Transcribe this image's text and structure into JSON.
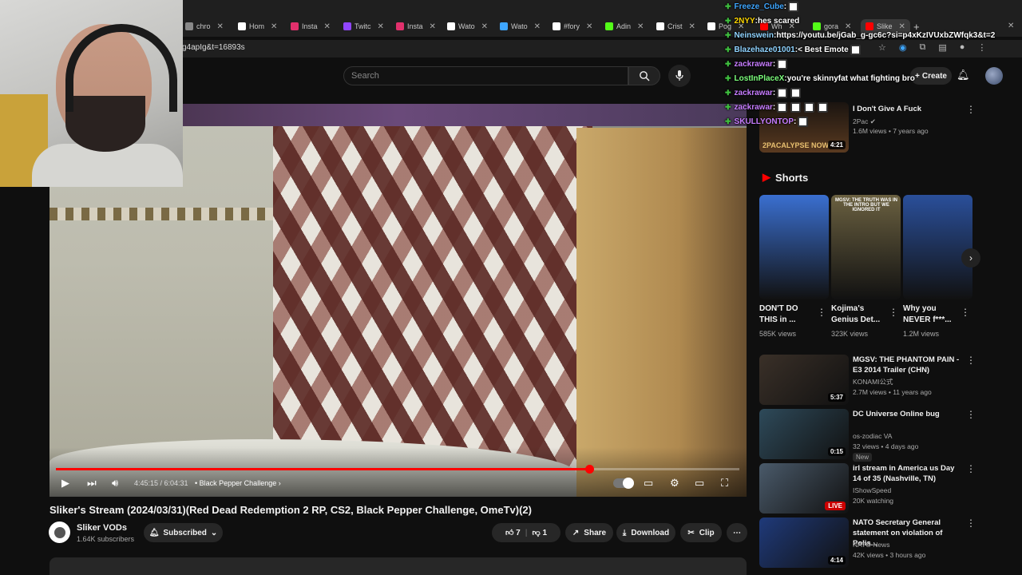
{
  "browser": {
    "tabs": [
      {
        "label": "chro",
        "color": "#888888"
      },
      {
        "label": "Hom",
        "color": "#ffffff"
      },
      {
        "label": "Insta",
        "color": "#e1306c"
      },
      {
        "label": "Twitc",
        "color": "#9146ff"
      },
      {
        "label": "Insta",
        "color": "#e1306c"
      },
      {
        "label": "Wato",
        "color": "#ffffff"
      },
      {
        "label": "Wato",
        "color": "#3ea6ff"
      },
      {
        "label": "#fory",
        "color": "#ffffff"
      },
      {
        "label": "Adin",
        "color": "#53fc18"
      },
      {
        "label": "Crist",
        "color": "#ffffff"
      },
      {
        "label": "Pog",
        "color": "#ffffff"
      },
      {
        "label": "Wh",
        "color": "#ff0000"
      },
      {
        "label": "gora",
        "color": "#53fc18"
      },
      {
        "label": "Slike",
        "color": "#ff0000"
      }
    ],
    "new_tab": "+",
    "url": "g4apIg&t=16893s"
  },
  "header": {
    "search_placeholder": "Search",
    "create_label": "Create"
  },
  "player": {
    "time": "4:45:15 / 6:04:31",
    "chapter": "• Black Pepper Challenge",
    "progress_fraction": 0.78
  },
  "video": {
    "title": "Sliker's Stream (2024/03/31)(Red Dead Redemption 2 RP, CS2, Black Pepper Challenge, OmeTv)(2)",
    "channel": "Sliker VODs",
    "subscribers": "1.64K subscribers",
    "subscribed_label": "Subscribed",
    "likes": "7",
    "dislikes": "1",
    "share_label": "Share",
    "download_label": "Download",
    "clip_label": "Clip"
  },
  "chat": [
    {
      "user": "Freeze_Cube",
      "text": "",
      "color": "#3ea6ff",
      "emotes": 1
    },
    {
      "user": "2NYY",
      "text": "hes scared",
      "color": "#ffd700",
      "emotes": 0
    },
    {
      "user": "Neinswein",
      "text": "https://youtu.be/jGab_g-gc6c?si=p4xKzIVUxbZWfqk3&t=2",
      "color": "#8fd3ff",
      "emotes": 0
    },
    {
      "user": "Blazehaze01001",
      "text": "< Best Emote",
      "color": "#8fd3ff",
      "emotes": 1
    },
    {
      "user": "zackrawar",
      "text": "",
      "color": "#c77dff",
      "emotes": 1
    },
    {
      "user": "LostInPlaceX",
      "text": "you're skinnyfat what fighting bro",
      "color": "#7cff7c",
      "emotes": 0
    },
    {
      "user": "zackrawar",
      "text": "",
      "color": "#c77dff",
      "emotes": 2
    },
    {
      "user": "zackrawar",
      "text": "",
      "color": "#c77dff",
      "emotes": 4
    },
    {
      "user": "SKULLYONTOP",
      "text": "",
      "color": "#c77dff",
      "emotes": 1
    }
  ],
  "related_top": {
    "title": "I Don't Give A Fuck",
    "channel": "2Pac",
    "meta": "1.6M views • 7 years ago",
    "duration": "4:21",
    "thumb_caption": "2PACALYPSE NOW"
  },
  "shorts": {
    "heading": "Shorts",
    "items": [
      {
        "title": "DON'T DO THIS in ...",
        "views": "585K views",
        "bg": "#3a6fd0"
      },
      {
        "title": "Kojima's Genius Det...",
        "views": "323K views",
        "bg": "#6a6040"
      },
      {
        "title": "Why you NEVER f***...",
        "views": "1.2M views",
        "bg": "#2a4f9a"
      }
    ],
    "thumb_caption": "MGSV: THE TRUTH WAS IN THE INTRO BUT WE IGNORED IT"
  },
  "related": [
    {
      "title": "MGSV: THE PHANTOM PAIN - E3 2014 Trailer (CHN)",
      "channel": "KONAMI公式",
      "meta": "2.7M views • 11 years ago",
      "duration": "5:37",
      "bg": "#3a3028",
      "badge": ""
    },
    {
      "title": "DC Universe Online bug",
      "channel": "os-zodiac VA",
      "meta": "32 views • 4 days ago",
      "duration": "0:15",
      "bg": "#2e4a5a",
      "badge": "New"
    },
    {
      "title": "irl stream in America us Day 14 of 35 (Nashville, TN)",
      "channel": "IShowSpeed",
      "meta": "20K watching",
      "duration": "LIVE",
      "bg": "#4a5a6a",
      "badge": ""
    },
    {
      "title": "NATO Secretary General statement on violation of Polis...",
      "channel": "NATO News",
      "meta": "42K views • 3 hours ago",
      "duration": "4:14",
      "bg": "#1f3a7a",
      "badge": ""
    }
  ]
}
